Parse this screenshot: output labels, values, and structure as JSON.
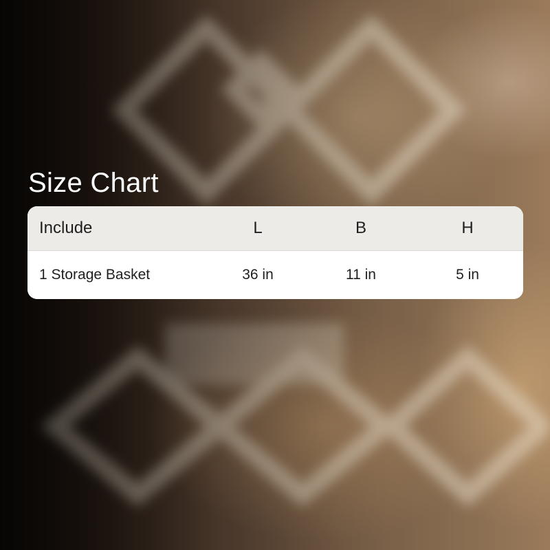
{
  "title": "Size Chart",
  "table": {
    "headers": [
      "Include",
      "L",
      "B",
      "H"
    ],
    "rows": [
      [
        "1 Storage Basket",
        "36 in",
        "11 in",
        "5 in"
      ]
    ]
  },
  "colors": {
    "header_bg": "#ecebe7",
    "row_bg": "#ffffff",
    "title_text": "#ffffff",
    "table_text": "#1f1f1f"
  }
}
